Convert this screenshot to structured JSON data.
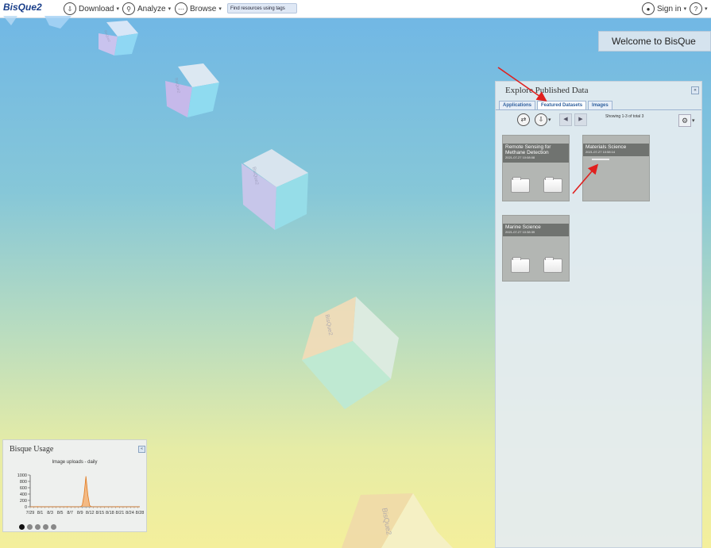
{
  "topbar": {
    "brand": "BisQue2",
    "download_label": "Download",
    "analyze_label": "Analyze",
    "browse_label": "Browse",
    "search_placeholder": "Find resources using tags",
    "signin_label": "Sign in",
    "help_label": "?"
  },
  "welcome": {
    "text": "Welcome to BisQue"
  },
  "explore": {
    "title": "Explore Published Data",
    "tabs": [
      "Applications",
      "Featured Datasets",
      "Images"
    ],
    "active_tab": "Featured Datasets",
    "showing": "Showing 1-3 of total 3",
    "cards": [
      {
        "name": "Remote Sensing for Methane Detection",
        "date": "2021-07-27 10:08:08"
      },
      {
        "name": "Materials Science",
        "date": "2021-07-27 10:58:14"
      },
      {
        "name": "Marine Science",
        "date": "2021-07-27 10:38:39"
      }
    ]
  },
  "cube_label": "BisQue2",
  "usage": {
    "title": "Bisque Usage",
    "carousel_dots": 5,
    "active_dot": 0
  },
  "chart_data": {
    "type": "area",
    "title": "Image uploads - daily",
    "xlabel": "",
    "ylabel": "",
    "ylim": [
      0,
      1000
    ],
    "yticks": [
      "1000",
      "800",
      "600",
      "400",
      "200",
      "0"
    ],
    "xtick_labels": [
      "7/29",
      "8/1",
      "8/3",
      "8/5",
      "8/7",
      "8/9",
      "8/12",
      "8/15",
      "8/18",
      "8/21",
      "8/24",
      "8/28"
    ],
    "series": [
      {
        "values": [
          0,
          0,
          0,
          0,
          5,
          0,
          0,
          0,
          0,
          0,
          0,
          0,
          0,
          0,
          0,
          0,
          0,
          0,
          0,
          0,
          5,
          0,
          0,
          0,
          0,
          0,
          0,
          0,
          40,
          380,
          960,
          380,
          40,
          0,
          0,
          0,
          0,
          0,
          0,
          0,
          0,
          0,
          0,
          0,
          0,
          0,
          0,
          5,
          0,
          0,
          0,
          0,
          0,
          0,
          0,
          0,
          0,
          0,
          0,
          0
        ]
      }
    ],
    "color": "#f4a860",
    "line_color": "#e07a20",
    "grid": false
  }
}
